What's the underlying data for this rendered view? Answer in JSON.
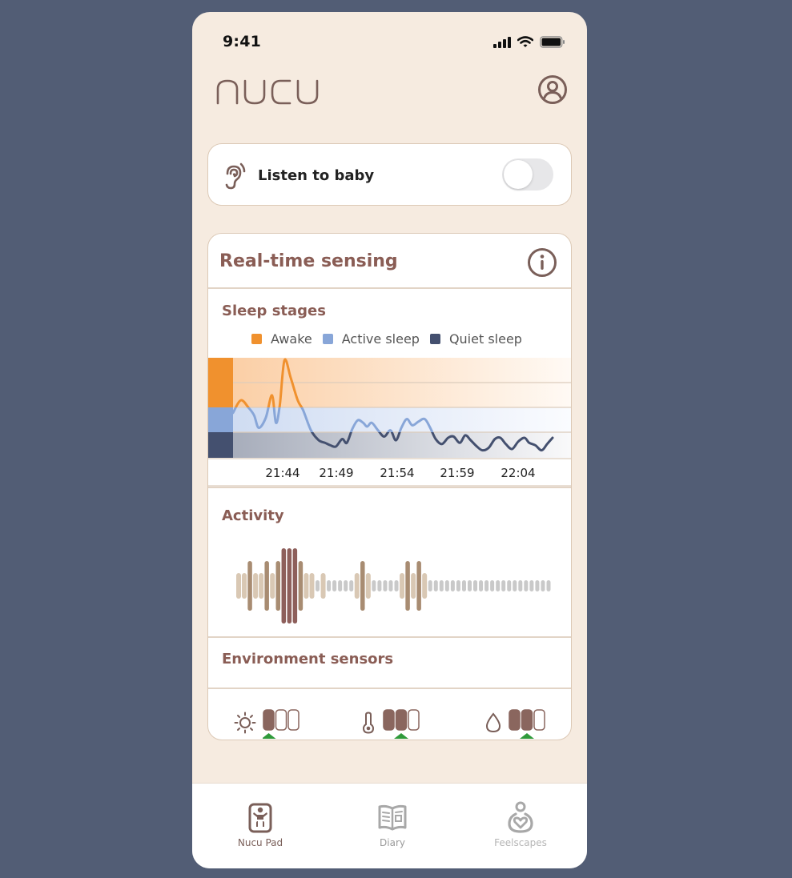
{
  "status_bar": {
    "time": "9:41"
  },
  "header": {
    "logo_text": "nucu",
    "profile_icon": "user-circle-icon"
  },
  "listen": {
    "label": "Listen to baby",
    "icon": "ear-icon",
    "toggle_on": false
  },
  "sensing": {
    "title": "Real-time sensing",
    "info_icon": "info-icon",
    "sleep_stages": {
      "title": "Sleep stages",
      "legend": [
        {
          "label": "Awake",
          "color": "#f0912e"
        },
        {
          "label": "Active sleep",
          "color": "#88a6d8"
        },
        {
          "label": "Quiet sleep",
          "color": "#44506f"
        }
      ]
    },
    "activity": {
      "title": "Activity"
    },
    "environment": {
      "title": "Environment sensors",
      "sensors": [
        {
          "name": "light",
          "icon": "sun-icon",
          "level": 1,
          "max": 3,
          "indicator": 1
        },
        {
          "name": "temperature",
          "icon": "thermometer-icon",
          "level": 2,
          "max": 3,
          "indicator": 2
        },
        {
          "name": "humidity",
          "icon": "droplet-icon",
          "level": 2,
          "max": 3,
          "indicator": 2
        }
      ]
    }
  },
  "chart_data": {
    "type": "line",
    "title": "Sleep stages",
    "xlabel": "",
    "ylabel": "",
    "x_ticks": [
      "21:44",
      "21:49",
      "21:54",
      "21:59",
      "22:04"
    ],
    "y_levels": [
      "Quiet sleep",
      "Active sleep",
      "Awake",
      "Awake"
    ],
    "ylim": [
      0,
      4
    ],
    "legend_position": "top",
    "series": [
      {
        "name": "sleep-stage-level",
        "x_minutes_from_start": [
          0,
          1,
          2,
          2.7,
          3.3,
          4.2,
          5,
          5.5,
          6,
          6.6,
          7.4,
          8.3,
          9,
          10,
          11,
          11.8,
          12.5,
          13.2,
          14,
          14.6,
          15.3,
          16,
          16.7,
          17.2,
          17.8,
          18.6,
          19.4,
          20.2,
          20.9,
          21.6,
          22.3,
          23,
          23.8,
          24.6,
          25.3,
          26,
          26.8,
          27.6,
          28.3,
          29.1,
          29.8,
          30.5,
          31.3,
          32,
          32.8,
          33.6,
          34.3,
          35,
          35.8,
          36.6,
          37.4,
          38,
          38.8,
          39.6,
          40.3,
          41
        ],
        "y": [
          1.8,
          2.3,
          2.0,
          1.7,
          1.2,
          1.6,
          2.5,
          1.4,
          2.1,
          3.9,
          3.2,
          2.3,
          1.9,
          1.1,
          0.7,
          0.6,
          0.5,
          0.45,
          0.75,
          0.6,
          1.15,
          1.5,
          1.4,
          1.25,
          1.4,
          1.1,
          0.85,
          1.1,
          0.7,
          1.2,
          1.55,
          1.3,
          1.45,
          1.55,
          1.2,
          0.75,
          0.55,
          0.8,
          0.85,
          0.6,
          0.9,
          0.7,
          0.45,
          0.3,
          0.4,
          0.75,
          0.8,
          0.55,
          0.35,
          0.65,
          0.8,
          0.6,
          0.5,
          0.3,
          0.55,
          0.8
        ]
      }
    ]
  },
  "activity_data": {
    "bars": [
      2,
      2,
      3,
      2,
      2,
      3,
      2,
      3,
      4,
      4,
      4,
      3,
      2,
      2,
      1,
      2,
      1,
      1,
      1,
      1,
      1,
      2,
      3,
      2,
      1,
      1,
      1,
      1,
      1,
      2,
      3,
      2,
      3,
      2,
      1,
      1,
      1,
      1,
      1,
      1,
      1,
      1,
      1,
      1,
      1,
      1,
      1,
      1,
      1,
      1,
      1,
      1,
      1,
      1,
      1,
      1
    ]
  },
  "tabbar": {
    "tabs": [
      {
        "label": "Nucu Pad",
        "icon": "baby-pad-icon",
        "active": true
      },
      {
        "label": "Diary",
        "icon": "book-icon",
        "active": false
      },
      {
        "label": "Feelscapes",
        "icon": "person-heart-icon",
        "active": false
      }
    ]
  },
  "colors": {
    "brand_brown": "#8a5d55",
    "icon_brown": "#7a5f59",
    "indicator_green": "#2f9a3b",
    "background": "#f6ebe0",
    "inactive_tab": "#a8a8a8"
  }
}
